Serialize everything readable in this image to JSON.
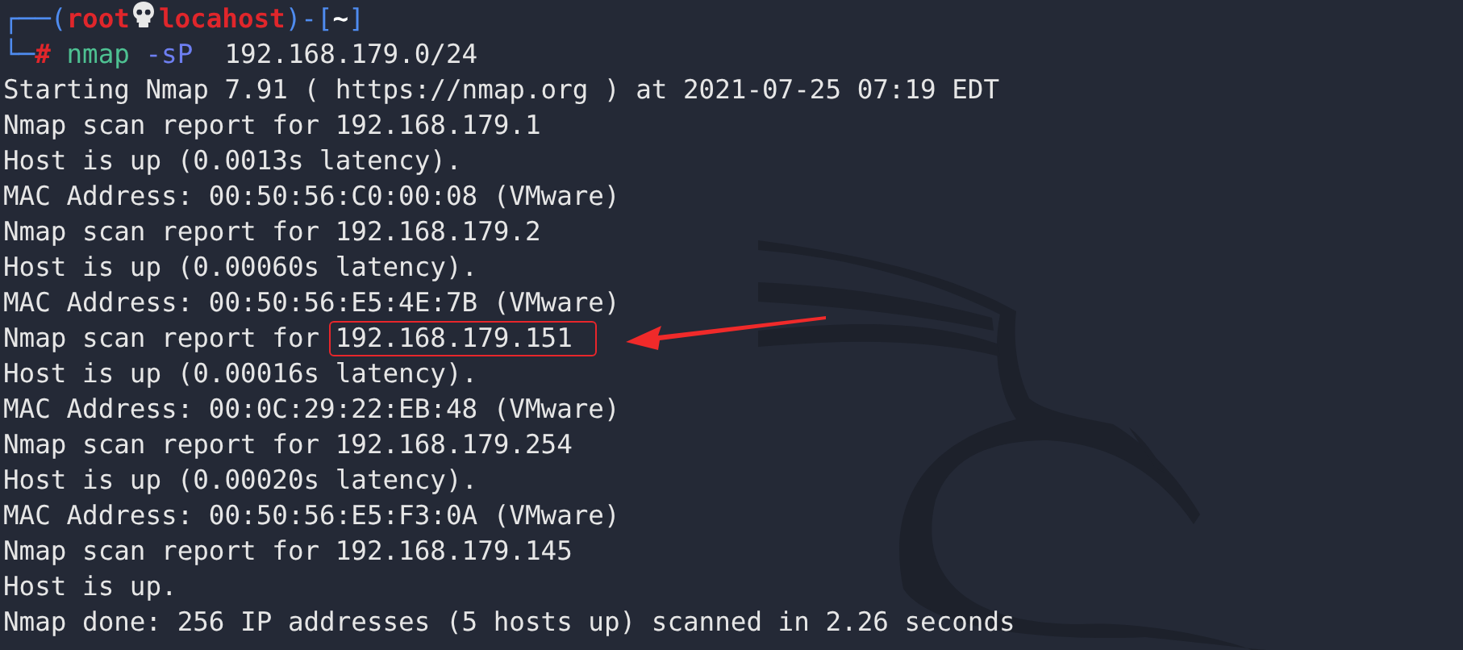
{
  "prompt": {
    "corner_top": "┌──(",
    "user": "root",
    "host": "locahost",
    "mid": ")-[",
    "cwd": "~",
    "close": "]",
    "corner_bottom": "└─",
    "symbol": "#",
    "command": {
      "program": "nmap",
      "flag": "-sP",
      "argument": "192.168.179.0/24"
    }
  },
  "output": [
    {
      "text": "Starting Nmap 7.91 ( https://nmap.org ) at 2021-07-25 07:19 EDT"
    },
    {
      "text": "Nmap scan report for 192.168.179.1"
    },
    {
      "text": "Host is up (0.0013s latency)."
    },
    {
      "text": "MAC Address: 00:50:56:C0:00:08 (VMware)"
    },
    {
      "text": "Nmap scan report for 192.168.179.2"
    },
    {
      "text": "Host is up (0.00060s latency)."
    },
    {
      "text": "MAC Address: 00:50:56:E5:4E:7B (VMware)"
    },
    {
      "text": "Nmap scan report for ",
      "boxed_text": "192.168.179.151"
    },
    {
      "text": "Host is up (0.00016s latency)."
    },
    {
      "text": "MAC Address: 00:0C:29:22:EB:48 (VMware)"
    },
    {
      "text": "Nmap scan report for 192.168.179.254"
    },
    {
      "text": "Host is up (0.00020s latency)."
    },
    {
      "text": "MAC Address: 00:50:56:E5:F3:0A (VMware)"
    },
    {
      "text": "Nmap scan report for 192.168.179.145"
    },
    {
      "text": "Host is up."
    },
    {
      "text": "Nmap done: 256 IP addresses (5 hosts up) scanned in 2.26 seconds"
    }
  ]
}
